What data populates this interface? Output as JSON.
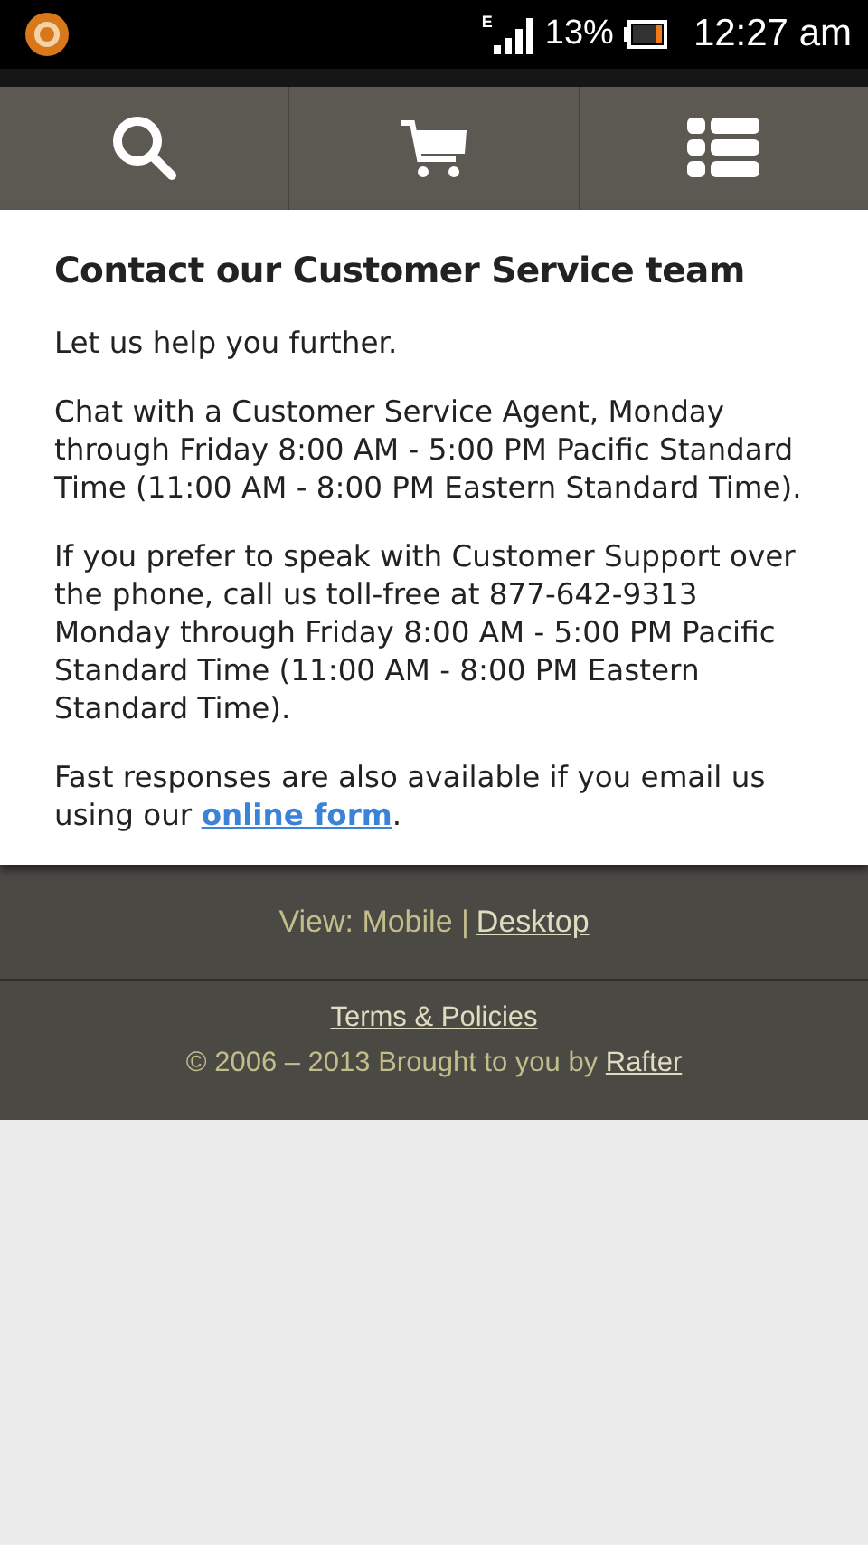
{
  "status_bar": {
    "network": "E",
    "battery": "13%",
    "time": "12:27 am"
  },
  "nav": [
    {
      "kind": "search"
    },
    {
      "kind": "cart"
    },
    {
      "kind": "menu"
    }
  ],
  "content": {
    "title": "Contact our Customer Service team",
    "paragraphs": [
      {
        "text": "Let us help you further."
      },
      {
        "text": "Chat with a Customer Service Agent, Monday through Friday 8:00 AM - 5:00 PM Pacific Standard Time (11:00 AM - 8:00 PM Eastern Standard Time)."
      },
      {
        "text": "If you prefer to speak with Customer Support over the phone, call us toll-free at 877-642-9313 Monday through Friday 8:00 AM - 5:00 PM Pacific Standard Time (11:00 AM - 8:00 PM Eastern Standard Time)."
      },
      {
        "text": "Fast responses are also available if you email us using our",
        "link": "online form",
        "after": "."
      }
    ]
  },
  "footer": {
    "view_label": "View: Mobile |",
    "view_link": "Desktop",
    "terms_link": "Terms & Policies",
    "copyright": "© 2006 – 2013 Brought to you by",
    "copyright_link": "Rafter"
  }
}
